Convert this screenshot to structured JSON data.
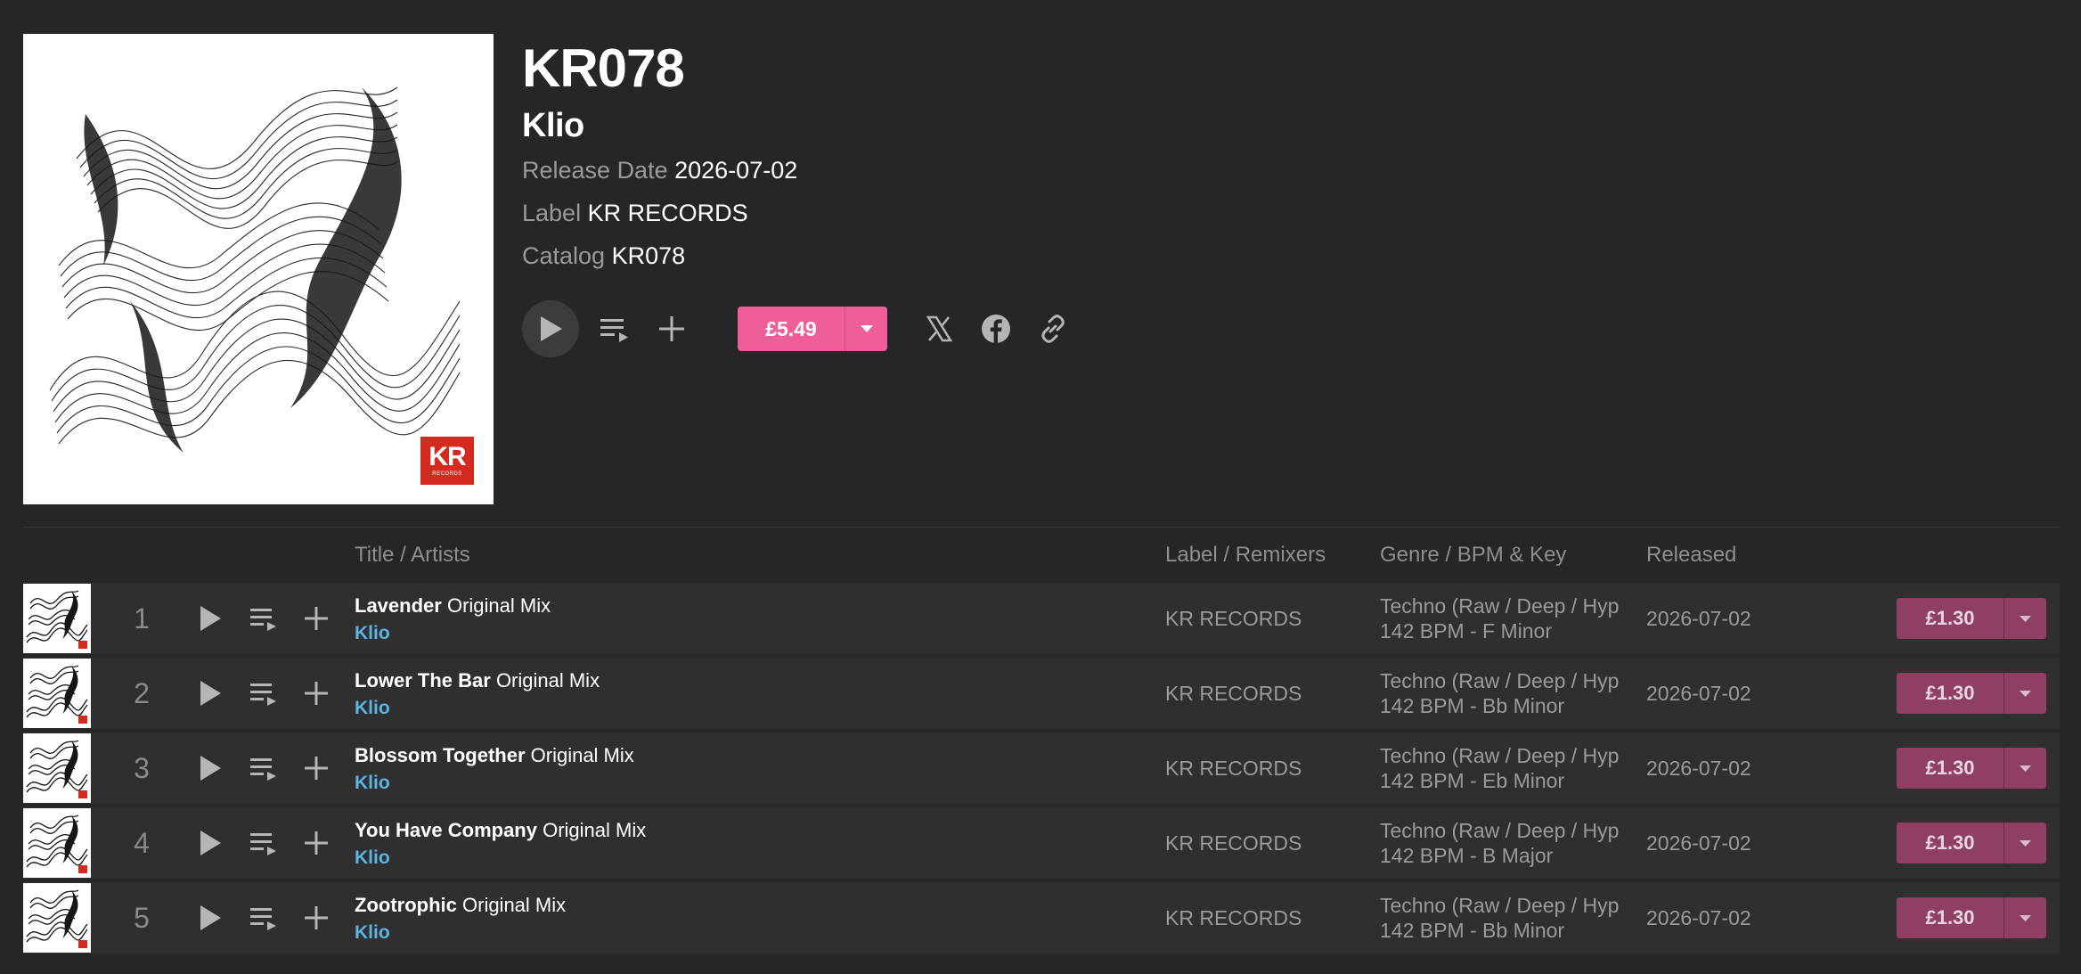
{
  "release": {
    "title": "KR078",
    "artist": "Klio",
    "meta": {
      "release_date_label": "Release Date",
      "release_date": "2026-07-02",
      "label_label": "Label",
      "label": "KR RECORDS",
      "catalog_label": "Catalog",
      "catalog": "KR078"
    },
    "price": "£5.49",
    "logo_text": "KR",
    "logo_subtext": "RECORDS"
  },
  "icons": {
    "play": "play-icon",
    "queue": "add-to-queue-icon",
    "add": "plus-icon",
    "dropdown": "caret-down-icon",
    "x": "x-twitter-icon",
    "facebook": "facebook-icon",
    "link": "link-icon"
  },
  "colors": {
    "background": "#262626",
    "row": "#2f2f2f",
    "accent_pink": "#ee5f9a",
    "row_price": "#8e3f62",
    "artist_link": "#5cb4e4"
  },
  "columns": {
    "title": "Title / Artists",
    "label": "Label / Remixers",
    "genre": "Genre / BPM & Key",
    "released": "Released"
  },
  "tracks": [
    {
      "num": "1",
      "name": "Lavender",
      "mix": "Original Mix",
      "artist": "Klio",
      "label": "KR RECORDS",
      "genre": "Techno (Raw / Deep / Hypnotic)",
      "bpm_key": "142 BPM - F Minor",
      "released": "2026-07-02",
      "price": "£1.30"
    },
    {
      "num": "2",
      "name": "Lower The Bar",
      "mix": "Original Mix",
      "artist": "Klio",
      "label": "KR RECORDS",
      "genre": "Techno (Raw / Deep / Hypnotic)",
      "bpm_key": "142 BPM - Bb Minor",
      "released": "2026-07-02",
      "price": "£1.30"
    },
    {
      "num": "3",
      "name": "Blossom Together",
      "mix": "Original Mix",
      "artist": "Klio",
      "label": "KR RECORDS",
      "genre": "Techno (Raw / Deep / Hypnotic)",
      "bpm_key": "142 BPM - Eb Minor",
      "released": "2026-07-02",
      "price": "£1.30"
    },
    {
      "num": "4",
      "name": "You Have Company",
      "mix": "Original Mix",
      "artist": "Klio",
      "label": "KR RECORDS",
      "genre": "Techno (Raw / Deep / Hypnotic)",
      "bpm_key": "142 BPM - B Major",
      "released": "2026-07-02",
      "price": "£1.30"
    },
    {
      "num": "5",
      "name": "Zootrophic",
      "mix": "Original Mix",
      "artist": "Klio",
      "label": "KR RECORDS",
      "genre": "Techno (Raw / Deep / Hypnotic)",
      "bpm_key": "142 BPM - Bb Minor",
      "released": "2026-07-02",
      "price": "£1.30"
    }
  ]
}
